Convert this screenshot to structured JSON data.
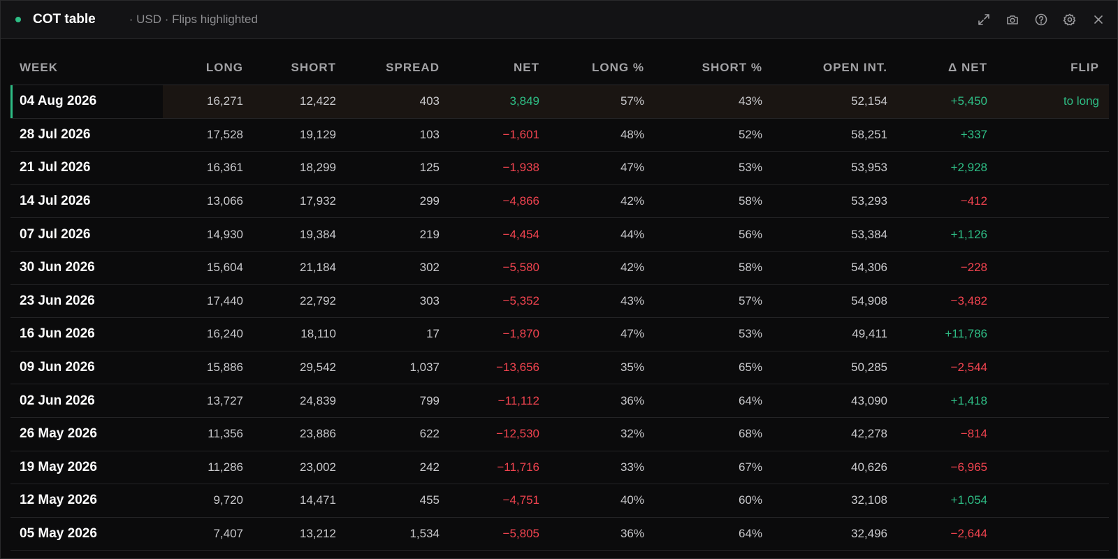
{
  "window": {
    "title": "COT table",
    "subtitle": "· USD · Flips highlighted",
    "actions": [
      "expand-icon",
      "camera-icon",
      "help-icon",
      "settings-icon",
      "close-icon"
    ]
  },
  "colors": {
    "positive": "#2ebd85",
    "negative": "#f0434f",
    "highlight_row": "#1a1512"
  },
  "table": {
    "headers": [
      "WEEK",
      "LONG",
      "SHORT",
      "SPREAD",
      "NET",
      "LONG %",
      "SHORT %",
      "OPEN INT.",
      "Δ NET",
      "FLIP"
    ],
    "rows": [
      {
        "week": "04 Aug 2026",
        "long": "16,271",
        "short": "12,422",
        "spread": "403",
        "net": "3,849",
        "net_sign": "pos",
        "long_pct": "57%",
        "short_pct": "43%",
        "open_int": "52,154",
        "delta_net": "+5,450",
        "delta_sign": "pos",
        "flip": "to long",
        "highlight": true
      },
      {
        "week": "28 Jul 2026",
        "long": "17,528",
        "short": "19,129",
        "spread": "103",
        "net": "−1,601",
        "net_sign": "neg",
        "long_pct": "48%",
        "short_pct": "52%",
        "open_int": "58,251",
        "delta_net": "+337",
        "delta_sign": "pos",
        "flip": "",
        "highlight": false
      },
      {
        "week": "21 Jul 2026",
        "long": "16,361",
        "short": "18,299",
        "spread": "125",
        "net": "−1,938",
        "net_sign": "neg",
        "long_pct": "47%",
        "short_pct": "53%",
        "open_int": "53,953",
        "delta_net": "+2,928",
        "delta_sign": "pos",
        "flip": "",
        "highlight": false
      },
      {
        "week": "14 Jul 2026",
        "long": "13,066",
        "short": "17,932",
        "spread": "299",
        "net": "−4,866",
        "net_sign": "neg",
        "long_pct": "42%",
        "short_pct": "58%",
        "open_int": "53,293",
        "delta_net": "−412",
        "delta_sign": "neg",
        "flip": "",
        "highlight": false
      },
      {
        "week": "07 Jul 2026",
        "long": "14,930",
        "short": "19,384",
        "spread": "219",
        "net": "−4,454",
        "net_sign": "neg",
        "long_pct": "44%",
        "short_pct": "56%",
        "open_int": "53,384",
        "delta_net": "+1,126",
        "delta_sign": "pos",
        "flip": "",
        "highlight": false
      },
      {
        "week": "30 Jun 2026",
        "long": "15,604",
        "short": "21,184",
        "spread": "302",
        "net": "−5,580",
        "net_sign": "neg",
        "long_pct": "42%",
        "short_pct": "58%",
        "open_int": "54,306",
        "delta_net": "−228",
        "delta_sign": "neg",
        "flip": "",
        "highlight": false
      },
      {
        "week": "23 Jun 2026",
        "long": "17,440",
        "short": "22,792",
        "spread": "303",
        "net": "−5,352",
        "net_sign": "neg",
        "long_pct": "43%",
        "short_pct": "57%",
        "open_int": "54,908",
        "delta_net": "−3,482",
        "delta_sign": "neg",
        "flip": "",
        "highlight": false
      },
      {
        "week": "16 Jun 2026",
        "long": "16,240",
        "short": "18,110",
        "spread": "17",
        "net": "−1,870",
        "net_sign": "neg",
        "long_pct": "47%",
        "short_pct": "53%",
        "open_int": "49,411",
        "delta_net": "+11,786",
        "delta_sign": "pos",
        "flip": "",
        "highlight": false
      },
      {
        "week": "09 Jun 2026",
        "long": "15,886",
        "short": "29,542",
        "spread": "1,037",
        "net": "−13,656",
        "net_sign": "neg",
        "long_pct": "35%",
        "short_pct": "65%",
        "open_int": "50,285",
        "delta_net": "−2,544",
        "delta_sign": "neg",
        "flip": "",
        "highlight": false
      },
      {
        "week": "02 Jun 2026",
        "long": "13,727",
        "short": "24,839",
        "spread": "799",
        "net": "−11,112",
        "net_sign": "neg",
        "long_pct": "36%",
        "short_pct": "64%",
        "open_int": "43,090",
        "delta_net": "+1,418",
        "delta_sign": "pos",
        "flip": "",
        "highlight": false
      },
      {
        "week": "26 May 2026",
        "long": "11,356",
        "short": "23,886",
        "spread": "622",
        "net": "−12,530",
        "net_sign": "neg",
        "long_pct": "32%",
        "short_pct": "68%",
        "open_int": "42,278",
        "delta_net": "−814",
        "delta_sign": "neg",
        "flip": "",
        "highlight": false
      },
      {
        "week": "19 May 2026",
        "long": "11,286",
        "short": "23,002",
        "spread": "242",
        "net": "−11,716",
        "net_sign": "neg",
        "long_pct": "33%",
        "short_pct": "67%",
        "open_int": "40,626",
        "delta_net": "−6,965",
        "delta_sign": "neg",
        "flip": "",
        "highlight": false
      },
      {
        "week": "12 May 2026",
        "long": "9,720",
        "short": "14,471",
        "spread": "455",
        "net": "−4,751",
        "net_sign": "neg",
        "long_pct": "40%",
        "short_pct": "60%",
        "open_int": "32,108",
        "delta_net": "+1,054",
        "delta_sign": "pos",
        "flip": "",
        "highlight": false
      },
      {
        "week": "05 May 2026",
        "long": "7,407",
        "short": "13,212",
        "spread": "1,534",
        "net": "−5,805",
        "net_sign": "neg",
        "long_pct": "36%",
        "short_pct": "64%",
        "open_int": "32,496",
        "delta_net": "−2,644",
        "delta_sign": "neg",
        "flip": "",
        "highlight": false
      }
    ]
  }
}
